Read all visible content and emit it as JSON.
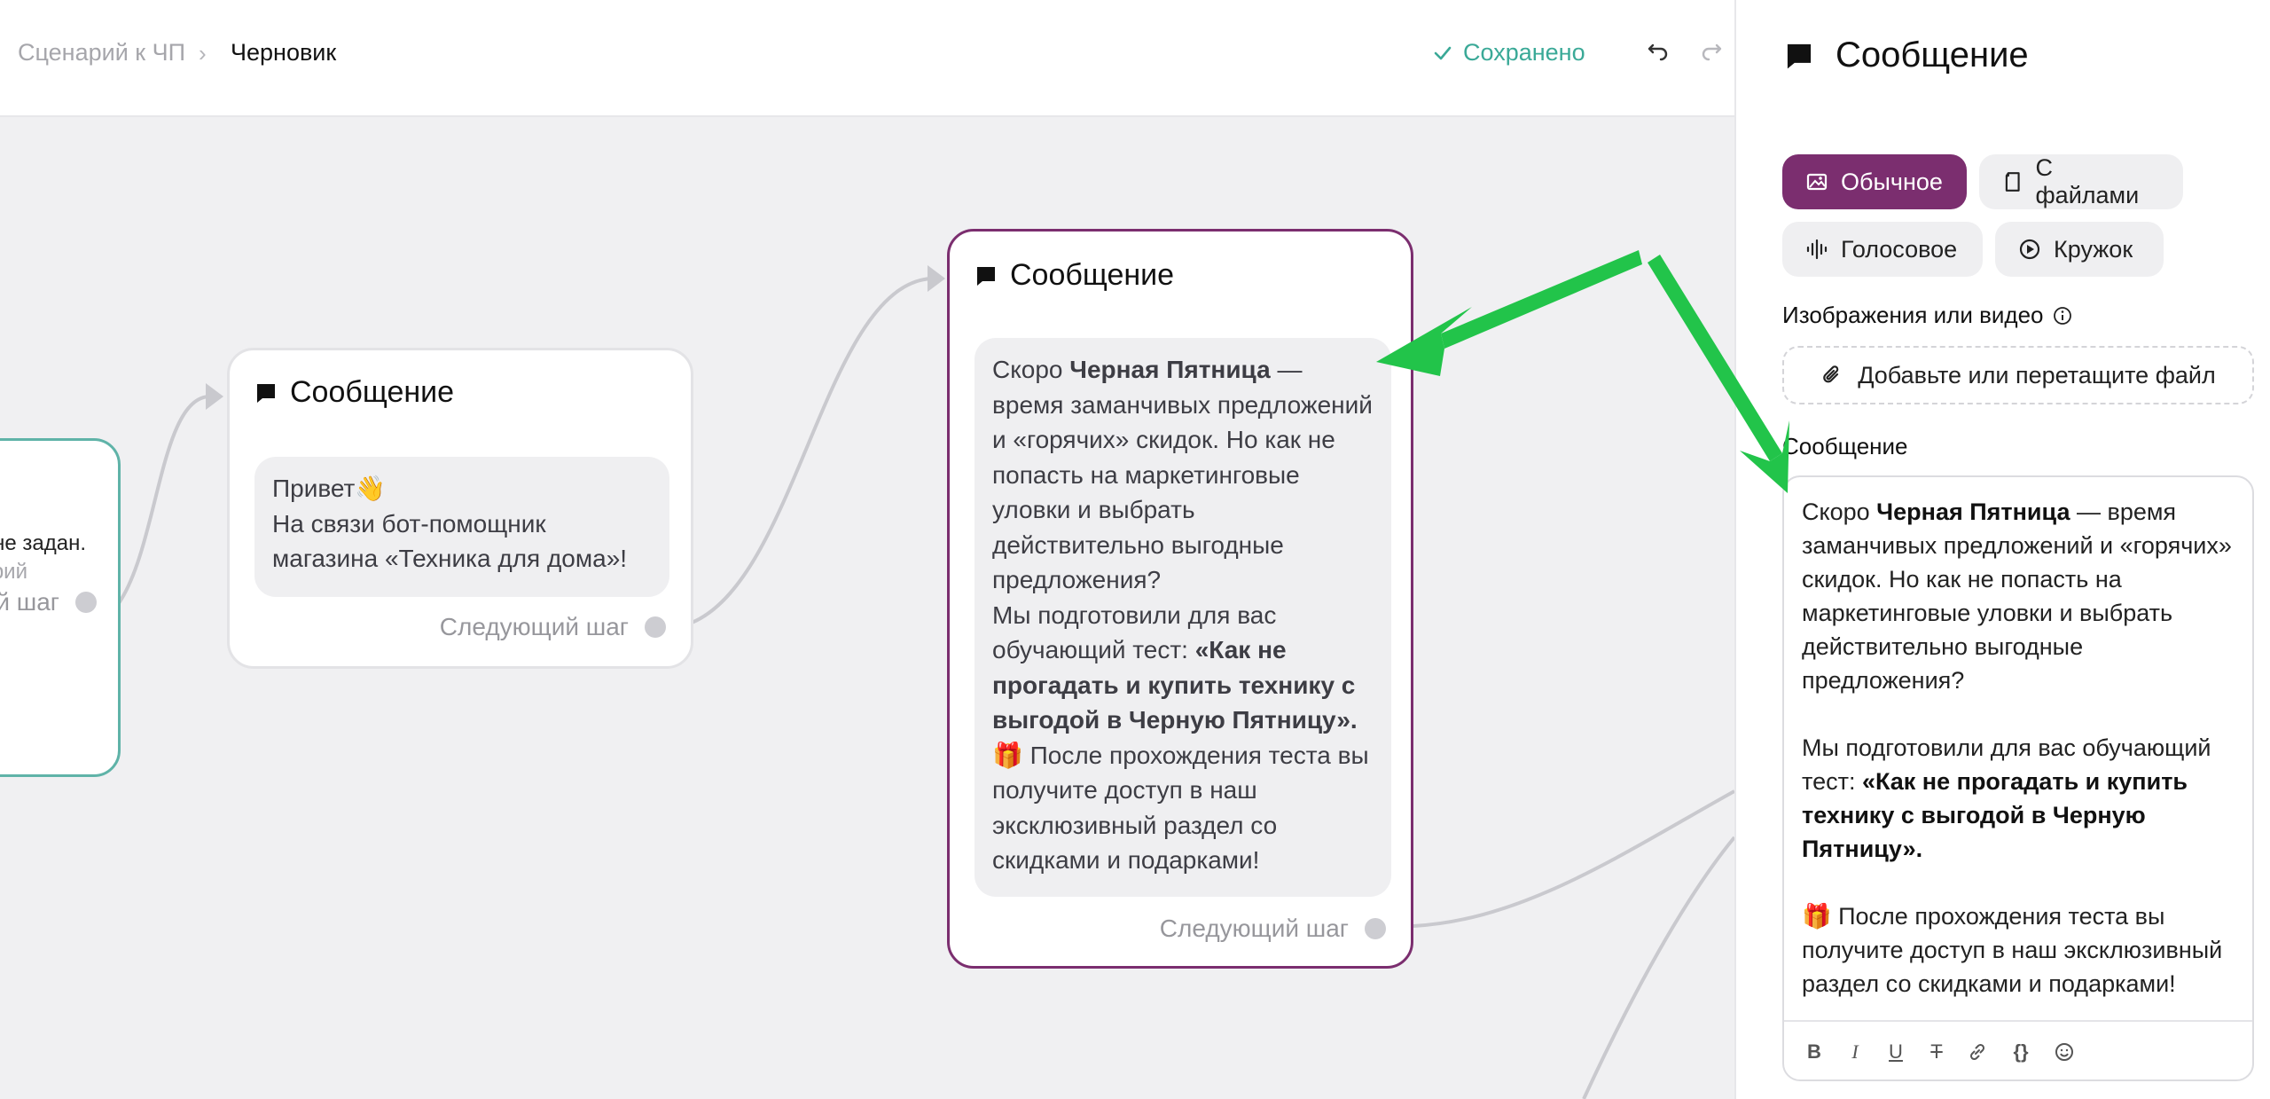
{
  "breadcrumb": {
    "parent": "Сценарий к ЧП",
    "separator": "›",
    "current": "Черновик"
  },
  "status": {
    "saved_label": "Сохранено"
  },
  "colors": {
    "accent": "#7b2e6f",
    "saved": "#3aa997",
    "trigger_border": "#5fb3a8",
    "arrow": "#22c44a"
  },
  "canvas": {
    "trigger_node": {
      "line1": "не задан.",
      "line2": "нарий",
      "next_label": "й шаг"
    },
    "node1": {
      "title": "Сообщение",
      "greeting": "Привет👋",
      "text": "На связи бот-помощник магазина «Техника для дома»!",
      "next_label": "Следующий шаг"
    },
    "node2": {
      "title": "Сообщение",
      "p1_a": "Скоро ",
      "p1_b": "Черная Пятница",
      "p1_c": " — время заманчивых предложений и «горячих» скидок. Но как не попасть на маркетинговые уловки и выбрать действительно выгодные предложения?",
      "p2_a": "Мы подготовили для вас обучающий тест: ",
      "p2_b": "«Как не прогадать и купить технику с выгодой в Черную Пятницу».",
      "p3": "🎁 После прохождения теста вы получите доступ в наш эксклюзивный раздел со скидками и подарками!",
      "next_label": "Следующий шаг"
    }
  },
  "panel": {
    "title": "Сообщение",
    "types": [
      "Обычное",
      "С файлами",
      "Голосовое",
      "Кружок"
    ],
    "media_label": "Изображения или видео",
    "dropzone_label": "Добавьте или перетащите файл",
    "message_label": "Сообщение",
    "editor": {
      "p1_a": "Скоро ",
      "p1_b": "Черная Пятница",
      "p1_c": " — время заманчивых предложений и «горячих» скидок. Но как не попасть на маркетинговые уловки и выбрать действительно выгодные предложения?",
      "p2_a": "Мы подготовили для вас обучающий тест: ",
      "p2_b": "«Как не прогадать и купить технику с выгодой в Черную Пятницу».",
      "p3": "🎁  После прохождения теста вы получите доступ в наш эксклюзивный раздел со скидками и подарками!"
    },
    "toolbar": {
      "bold": "B",
      "italic": "I",
      "underline": "U",
      "strike": "T",
      "code": "{}"
    }
  }
}
